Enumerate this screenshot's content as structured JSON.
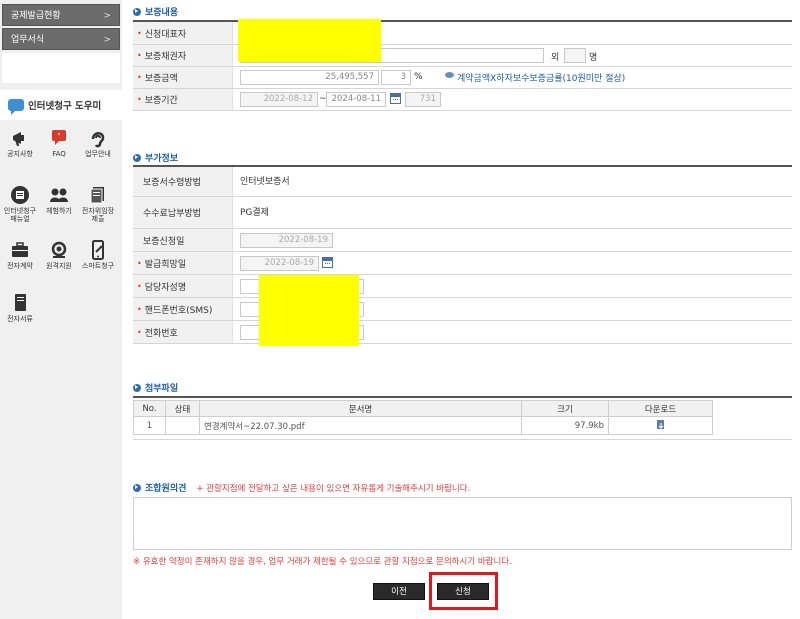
{
  "sidebar": {
    "menus": [
      "공제발급현황",
      "업무서식"
    ],
    "chevron": ">",
    "helper_title": "인터넷청구 도우미",
    "tools": [
      {
        "icon": "megaphone-icon",
        "label": "공지사항"
      },
      {
        "icon": "faq-icon",
        "label": "FAQ"
      },
      {
        "icon": "ear-icon",
        "label": "업무안내"
      },
      {
        "icon": "manual-icon",
        "label": "인터넷청구 매뉴얼"
      },
      {
        "icon": "people-icon",
        "label": "체험하기"
      },
      {
        "icon": "document-stack-icon",
        "label": "전자위임장 제출"
      },
      {
        "icon": "briefcase-icon",
        "label": "전자계약"
      },
      {
        "icon": "headset-icon",
        "label": "원격지원"
      },
      {
        "icon": "smartphone-icon",
        "label": "스마트청구"
      },
      {
        "icon": "file-icon",
        "label": "전자서류"
      }
    ]
  },
  "guarantee": {
    "title": "보증내용",
    "applicant_label": "신청대표자",
    "creditor_label": "보증채권자",
    "creditor_extra": "외",
    "creditor_unit": "명",
    "amount_label": "보증금액",
    "amount_value": "25,495,557",
    "rate_value": "3",
    "rate_unit": "%",
    "amount_note": "계약금액X하자보수보증금률(10원미만 절상)",
    "period_label": "보증기간",
    "period_start": "2022-08-12",
    "period_tilde": "~",
    "period_end": "2024-08-11",
    "period_days": "731"
  },
  "extra": {
    "title": "부가정보",
    "receive_label": "보증서수령방법",
    "receive_value": "인터넷보증서",
    "fee_label": "수수료납부방법",
    "fee_value": "PG결제",
    "apply_date_label": "보증신청일",
    "apply_date_value": "2022-08-19",
    "issue_date_label": "발급희망일",
    "issue_date_value": "2022-08-19",
    "manager_label": "담당자성명",
    "phone_label": "핸드폰번호(SMS)",
    "tel_label": "전화번호"
  },
  "attachments": {
    "title": "첨부파일",
    "headers": [
      "No.",
      "상태",
      "문서명",
      "크기",
      "다운로드"
    ],
    "rows": [
      {
        "no": "1",
        "status": "",
        "name": "변경계약서~22.07.30.pdf",
        "size": "97.9kb"
      }
    ]
  },
  "opinion": {
    "title": "조합원의견",
    "note": "+ 관할지점에 전달하고 싶은 내용이 있으면 자유롭게 기술해주시기 바랍니다."
  },
  "warning": "※ 유효한 약정이 존재하지 않을 경우, 업무 거래가 제한될 수 있으므로 관할 지점으로 문의하시기 바랍니다.",
  "buttons": {
    "prev": "이전",
    "submit": "신청"
  },
  "colors": {
    "accent": "#1f5fa0",
    "highlight": "#ffff00",
    "warning": "#e23b3b",
    "outline": "#e0191e"
  }
}
